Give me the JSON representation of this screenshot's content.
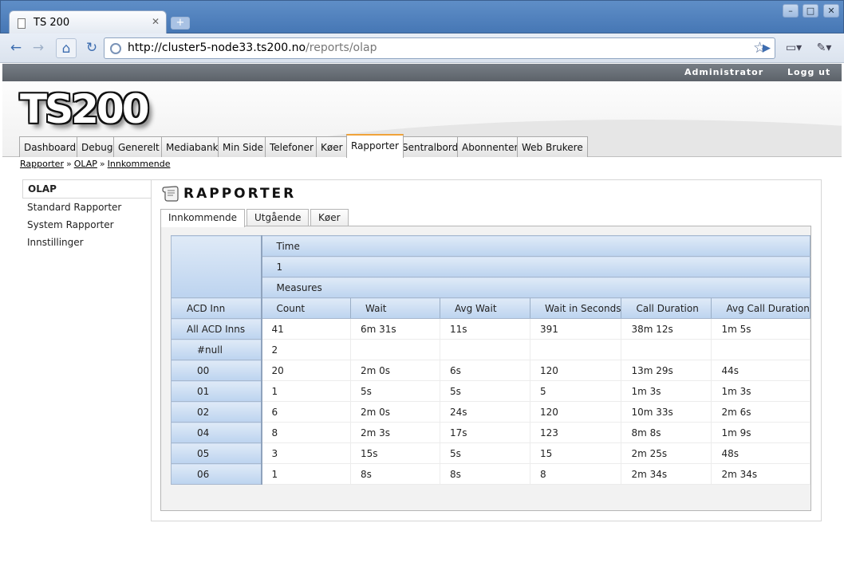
{
  "browser": {
    "tab_title": "TS 200",
    "url_host": "http://cluster5-node33.ts200.no",
    "url_path": "/reports/olap"
  },
  "adminbar": {
    "user": "Administrator",
    "logout": "Logg ut"
  },
  "logo": "TS200",
  "nav": {
    "tabs": [
      "Dashboard",
      "Debug",
      "Generelt",
      "Mediabank",
      "Min Side",
      "Telefoner",
      "Køer",
      "Rapporter",
      "Sentralbord",
      "Abonnenter",
      "Web Brukere"
    ],
    "active": "Rapporter"
  },
  "breadcrumb": [
    "Rapporter",
    "OLAP",
    "Innkommende"
  ],
  "sidebar": {
    "items": [
      "OLAP",
      "Standard Rapporter",
      "System Rapporter",
      "Innstillinger"
    ]
  },
  "panel": {
    "title": "RAPPORTER"
  },
  "subtabs": [
    "Innkommende",
    "Utgående",
    "Køer"
  ],
  "olap": {
    "col_dimension": "Time",
    "col_member": "1",
    "measures_label": "Measures",
    "row_dimension": "ACD Inn",
    "columns": [
      "Count",
      "Wait",
      "Avg Wait",
      "Wait in Seconds",
      "Call Duration",
      "Avg Call Duration"
    ],
    "rows": [
      {
        "label": "All ACD Inns",
        "values": [
          "41",
          "6m 31s",
          "11s",
          "391",
          "38m 12s",
          "1m 5s"
        ]
      },
      {
        "label": "#null",
        "values": [
          "2",
          "",
          "",
          "",
          "",
          ""
        ]
      },
      {
        "label": "00",
        "values": [
          "20",
          "2m 0s",
          "6s",
          "120",
          "13m 29s",
          "44s"
        ]
      },
      {
        "label": "01",
        "values": [
          "1",
          "5s",
          "5s",
          "5",
          "1m 3s",
          "1m 3s"
        ]
      },
      {
        "label": "02",
        "values": [
          "6",
          "2m 0s",
          "24s",
          "120",
          "10m 33s",
          "2m 6s"
        ]
      },
      {
        "label": "04",
        "values": [
          "8",
          "2m 3s",
          "17s",
          "123",
          "8m 8s",
          "1m 9s"
        ]
      },
      {
        "label": "05",
        "values": [
          "3",
          "15s",
          "5s",
          "15",
          "2m 25s",
          "48s"
        ]
      },
      {
        "label": "06",
        "values": [
          "1",
          "8s",
          "8s",
          "8",
          "2m 34s",
          "2m 34s"
        ]
      }
    ]
  }
}
